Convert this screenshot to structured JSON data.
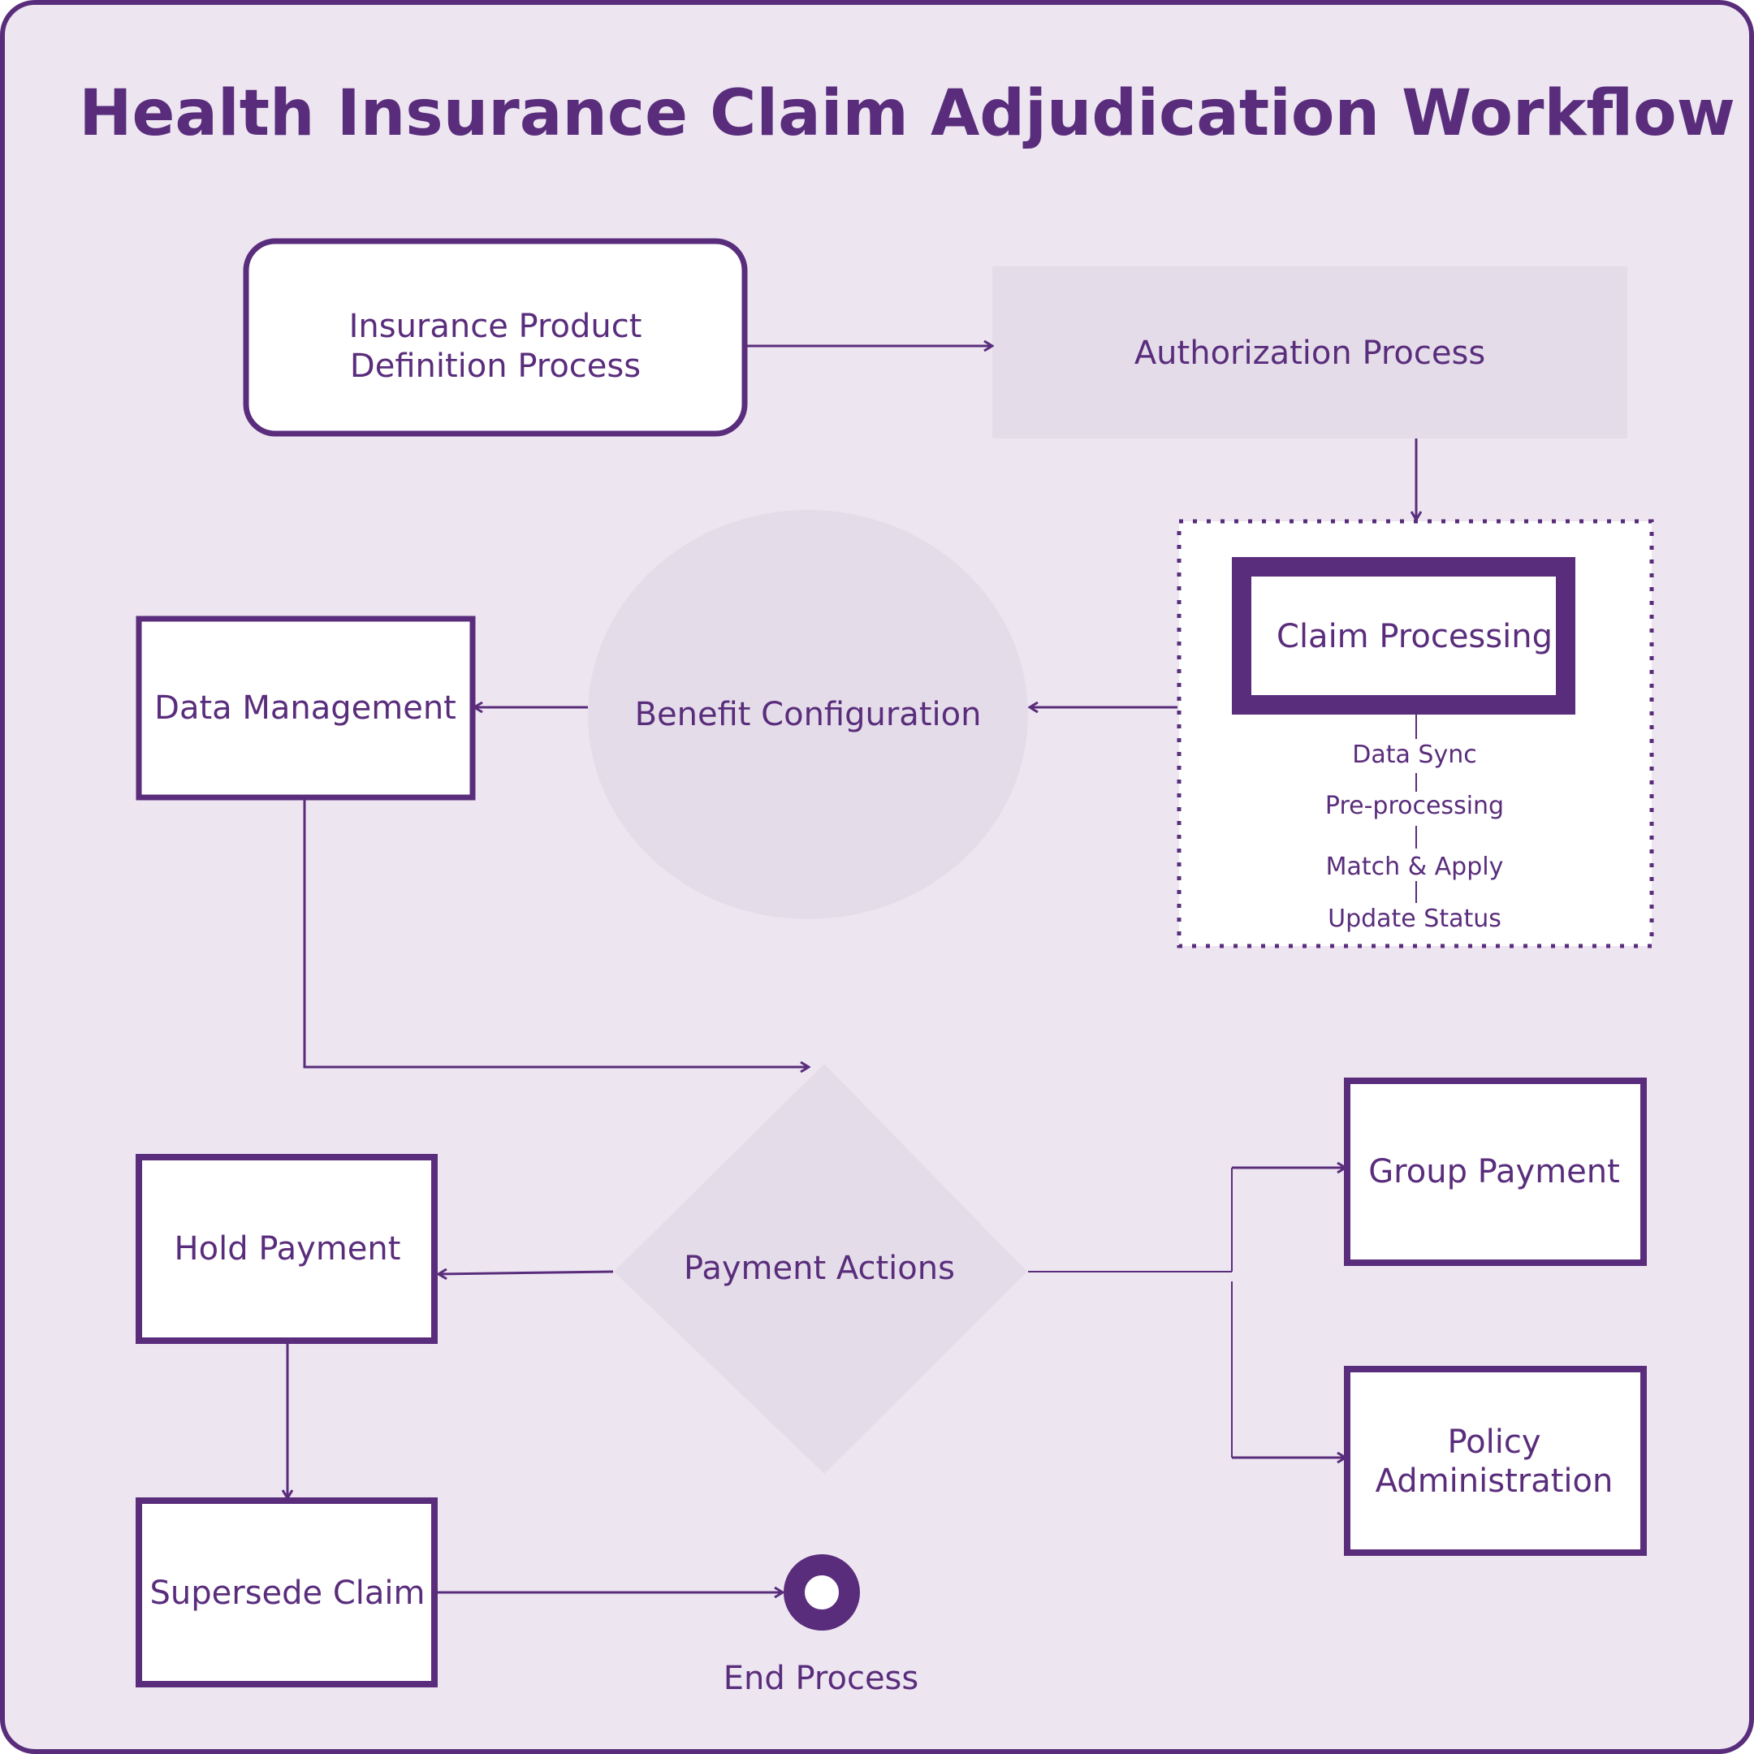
{
  "title": "Health Insurance Claim Adjudication Workflow",
  "colors": {
    "accent": "#5a2d7c",
    "background": "#ede6f1",
    "node_fill": "#ffffff",
    "muted_fill": "#e4dde9"
  },
  "nodes": {
    "product_definition": {
      "line1": "Insurance Product",
      "line2": "Definition Process"
    },
    "authorization": {
      "label": "Authorization Process"
    },
    "claim_processing": {
      "label": "Claim Processing",
      "steps": [
        "Data Sync",
        "Pre-processing",
        "Match & Apply",
        "Update Status"
      ]
    },
    "benefit_configuration": {
      "label": "Benefit Configuration"
    },
    "data_management": {
      "label": "Data Management"
    },
    "payment_actions": {
      "label": "Payment Actions"
    },
    "hold_payment": {
      "label": "Hold Payment"
    },
    "supersede_claim": {
      "label": "Supersede Claim"
    },
    "group_payment": {
      "label": "Group Payment"
    },
    "policy_administration": {
      "line1": "Policy",
      "line2": "Administration"
    },
    "end_process": {
      "label": "End Process"
    }
  }
}
